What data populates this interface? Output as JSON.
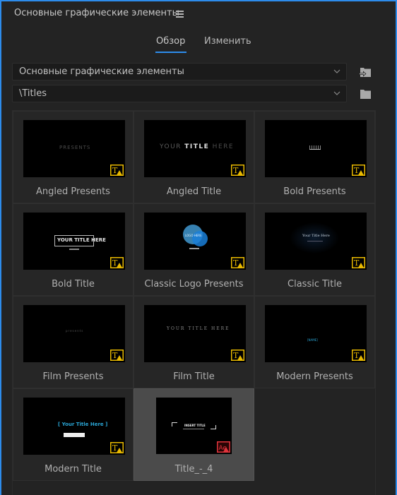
{
  "panel": {
    "title": "Основные графические элементы",
    "menu_icon": "hamburger-menu-icon",
    "accent_color": "#2d8ceb"
  },
  "tabs": [
    {
      "label": "Обзор",
      "active": true
    },
    {
      "label": "Изменить",
      "active": false
    }
  ],
  "library_dropdown": {
    "value": "Основные графические элементы",
    "icon": "import-to-library-icon"
  },
  "folder_dropdown": {
    "value": "\\Titles",
    "icon": "folder-icon"
  },
  "templates": [
    {
      "name": "Angled Presents",
      "badge": "premiere-title-warning",
      "preview_text": "PRESENTS"
    },
    {
      "name": "Angled Title",
      "badge": "premiere-title-warning",
      "preview_text_a": "YOUR ",
      "preview_text_b": "TITLE",
      "preview_text_c": " HERE"
    },
    {
      "name": "Bold Presents",
      "badge": "premiere-title-warning",
      "preview_text": "BBBBB"
    },
    {
      "name": "Bold Title",
      "badge": "premiere-title-warning",
      "preview_text": "YOUR TITLE HERE"
    },
    {
      "name": "Classic Logo Presents",
      "badge": "premiere-title-warning",
      "preview_text": "LOGO HERE"
    },
    {
      "name": "Classic Title",
      "badge": "premiere-title-warning",
      "preview_text": "Your Title Here"
    },
    {
      "name": "Film Presents",
      "badge": "premiere-title-warning",
      "preview_text": "presents"
    },
    {
      "name": "Film Title",
      "badge": "premiere-title-warning",
      "preview_text": "YOUR TITLE HERE"
    },
    {
      "name": "Modern Presents",
      "badge": "premiere-title-warning",
      "preview_text": "[NAME]"
    },
    {
      "name": "Modern Title",
      "badge": "premiere-title-warning",
      "preview_text": "[ Your Title Here ]"
    },
    {
      "name": "Title_-_4",
      "badge": "after-effects-warning",
      "selected": true,
      "preview_text": "INSERT TITLE"
    }
  ],
  "badge_colors": {
    "premiere": "#e8b900",
    "after_effects": "#e0343c"
  }
}
